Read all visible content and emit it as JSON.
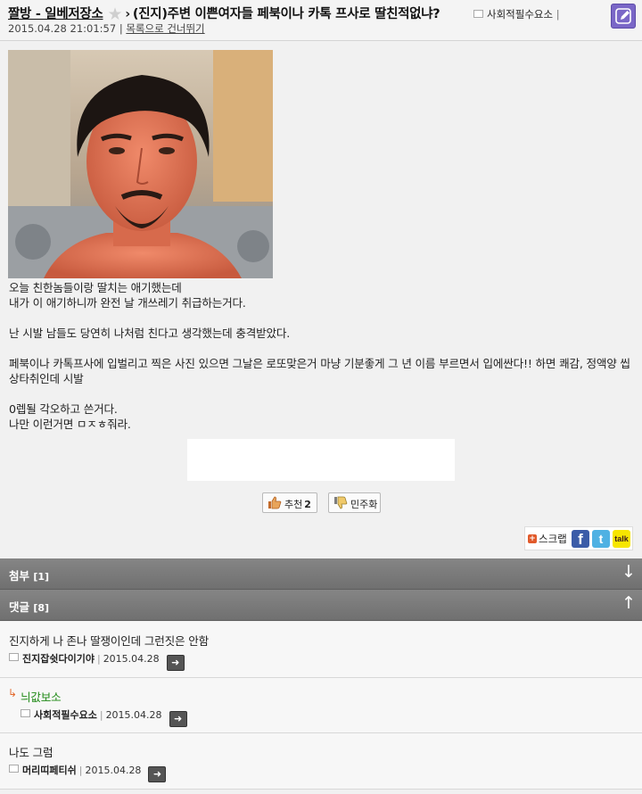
{
  "header": {
    "board": "짤방 - 일베저장소",
    "separator": "›",
    "title": "(진지)주변 이쁜여자들 페북이나 카톡 프사로 딸친적없냐?",
    "author": "사회적필수요소",
    "date": "2015.04.28 21:01:57",
    "meta_sep": "|",
    "to_list": "목록으로 건너뛰기",
    "star_icon": "star-icon",
    "edit_icon": "pencil-icon"
  },
  "post": {
    "paragraphs": [
      [
        " 오늘 친한놈들이랑 딸치는 애기했는데",
        "내가 이 애기하니까 완전 날 개쓰레기 취급하는거다."
      ],
      [
        "난 시발 남들도 당연히 나처럼 친다고 생각했는데 충격받았다."
      ],
      [
        "페북이나 카톡프사에 입벌리고 찍은 사진 있으면 그날은 로또맞은거 마냥 기분좋게 그 년 이름 부르면서 입에싼다!!  하면 쾌감, 정액양 씹상타취인데 시발"
      ],
      [
        "0렙될 각오하고 쓴거다.",
        "나만 이런거면 ㅁㅈㅎ줘라."
      ]
    ]
  },
  "votes": {
    "up_label": "추천",
    "up_count": "2",
    "down_label": "민주화"
  },
  "share": {
    "scrap_label": "스크랩",
    "facebook": "f",
    "twitter": "t",
    "kakao": "talk"
  },
  "sections": {
    "attach_label": "첨부",
    "attach_count": "[1]",
    "attach_arrow": "↓",
    "comments_label": "댓글",
    "comments_count": "[8]",
    "comments_arrow": "↑"
  },
  "comments": [
    {
      "text": "진지하게 나 존나 딸쟁이인데 그런짓은 안함",
      "author": "진지잡쉿다이기야",
      "date": "2015.04.28",
      "reply": false
    },
    {
      "text": "늬값보소",
      "author": "사회적필수요소",
      "date": "2015.04.28",
      "reply": true
    },
    {
      "text": "나도 그럼",
      "author": "머리띠페티쉬",
      "date": "2015.04.28",
      "reply": false
    }
  ],
  "colors": {
    "bar": "#7a7a7a",
    "edit_button": "#7a67c7",
    "reply_text": "#1f8a16",
    "reply_arrow": "#e36a2e"
  }
}
